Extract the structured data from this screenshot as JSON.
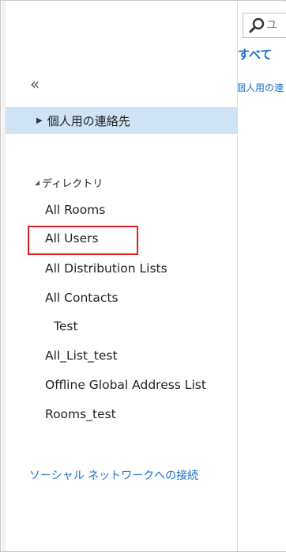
{
  "sidebar": {
    "collapse_glyph": "«",
    "personal_contacts": {
      "label": "個人用の連絡先"
    },
    "directory": {
      "label": "ディレクトリ",
      "items": [
        {
          "label": "All Rooms"
        },
        {
          "label": "All Users"
        },
        {
          "label": "All Distribution Lists"
        },
        {
          "label": "All Contacts"
        },
        {
          "label": "Test"
        },
        {
          "label": "All_List_test"
        },
        {
          "label": "Offline Global Address List"
        },
        {
          "label": "Rooms_test"
        }
      ]
    },
    "social_link": "ソーシャル ネットワークへの接続"
  },
  "main": {
    "search_placeholder": "ユ",
    "tab_all": "すべて",
    "personal_link": "個人用の連"
  },
  "colors": {
    "selected_bg": "#cfe3f4",
    "link": "#1a6fc4",
    "highlight_border": "#e02020"
  }
}
